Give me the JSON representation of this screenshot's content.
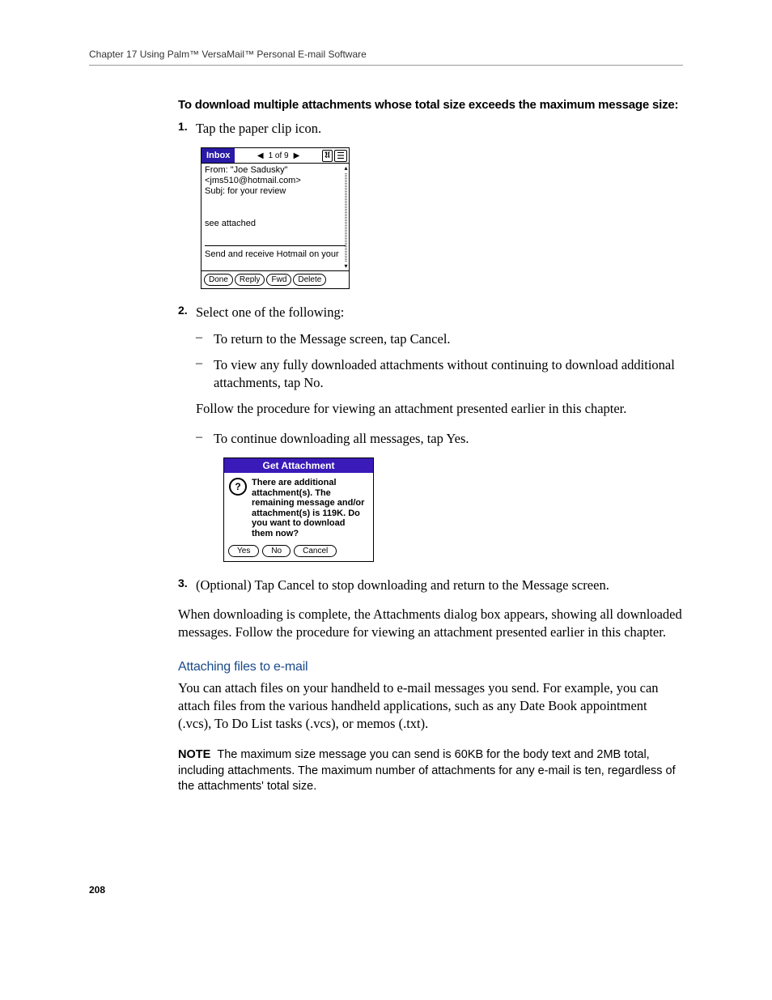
{
  "header": {
    "running": "Chapter 17   Using Palm™ VersaMail™ Personal E-mail Software"
  },
  "section": {
    "lead": "To download multiple attachments whose total size exceeds the maximum message size:"
  },
  "steps": {
    "s1": {
      "num": "1.",
      "text": "Tap the paper clip icon."
    },
    "s2": {
      "num": "2.",
      "text": "Select one of the following:"
    },
    "s3": {
      "num": "3.",
      "text": "(Optional) Tap Cancel to stop downloading and return to the Message screen."
    }
  },
  "bullets": {
    "b1": "To return to the Message screen, tap Cancel.",
    "b2": "To view any fully downloaded attachments without continuing to download additional attachments, tap No.",
    "b3": "To continue downloading all messages, tap Yes."
  },
  "paras": {
    "follow": "Follow the procedure for viewing an attachment presented earlier in this chapter.",
    "after3": "When downloading is complete, the Attachments dialog box appears, showing all downloaded messages. Follow the procedure for viewing an attachment presented earlier in this chapter.",
    "blue_heading": "Attaching files to e-mail",
    "attach_body": "You can attach files on your handheld to e-mail messages you send. For example, you can attach files from the various handheld applications, such as any Date Book appointment (.vcs), To Do List tasks (.vcs), or memos (.txt).",
    "note_label": "NOTE",
    "note_body": "The maximum size message you can send is 60KB for the body text and 2MB total, including attachments. The maximum number of attachments for any e-mail is ten, regardless of the attachments' total size."
  },
  "shot1": {
    "inbox": "Inbox",
    "counter": "1 of 9",
    "from": "From: \"Joe Sadusky\"",
    "email": "<jms510@hotmail.com>",
    "subj": "Subj: for your review",
    "body": "see attached",
    "footer": "Send and receive Hotmail on your",
    "btn_done": "Done",
    "btn_reply": "Reply",
    "btn_fwd": "Fwd",
    "btn_delete": "Delete"
  },
  "shot2": {
    "title": "Get Attachment",
    "icon": "?",
    "msg": "There are additional attachment(s). The remaining message and/or attachment(s) is 119K. Do you want to download them now?",
    "btn_yes": "Yes",
    "btn_no": "No",
    "btn_cancel": "Cancel"
  },
  "page_number": "208"
}
